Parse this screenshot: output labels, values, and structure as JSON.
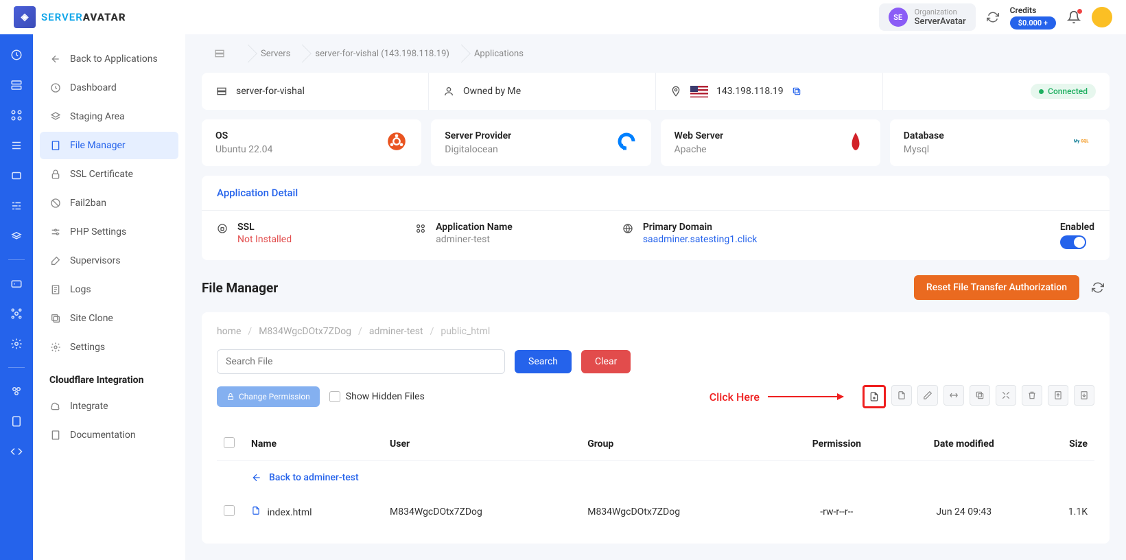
{
  "header": {
    "logo_text_1": "SERVER",
    "logo_text_2": "AVATAR",
    "org_label": "Organization",
    "org_name": "ServerAvatar",
    "org_initials": "SE",
    "credits_label": "Credits",
    "credits_value": "$0.000 +"
  },
  "breadcrumb_top": {
    "servers": "Servers",
    "server_detail": "server-for-vishal (143.198.118.19)",
    "applications": "Applications"
  },
  "sidenav": {
    "back": "Back to Applications",
    "items": [
      "Dashboard",
      "Staging Area",
      "File Manager",
      "SSL Certificate",
      "Fail2ban",
      "PHP Settings",
      "Supervisors",
      "Logs",
      "Site Clone",
      "Settings"
    ],
    "section": "Cloudflare Integration",
    "integrate": "Integrate",
    "docs": "Documentation"
  },
  "info_row": {
    "server_name": "server-for-vishal",
    "owner": "Owned by Me",
    "ip": "143.198.118.19",
    "status": "Connected"
  },
  "cards": {
    "os_title": "OS",
    "os_value": "Ubuntu 22.04",
    "provider_title": "Server Provider",
    "provider_value": "Digitalocean",
    "web_title": "Web Server",
    "web_value": "Apache",
    "db_title": "Database",
    "db_value": "Mysql"
  },
  "detail": {
    "header": "Application Detail",
    "ssl_label": "SSL",
    "ssl_value": "Not Installed",
    "app_label": "Application Name",
    "app_value": "adminer-test",
    "domain_label": "Primary Domain",
    "domain_value": "saadminer.satesting1.click",
    "enabled_label": "Enabled"
  },
  "fm": {
    "title": "File Manager",
    "reset_btn": "Reset File Transfer Authorization",
    "path": {
      "p1": "home",
      "p2": "M834WgcDOtx7ZDog",
      "p3": "adminer-test",
      "p4": "public_html"
    },
    "search_placeholder": "Search File",
    "search_btn": "Search",
    "clear_btn": "Clear",
    "change_perm": "Change Permission",
    "show_hidden": "Show Hidden Files",
    "annotation_text": "Click Here",
    "cols": {
      "name": "Name",
      "user": "User",
      "group": "Group",
      "permission": "Permission",
      "date": "Date modified",
      "size": "Size"
    },
    "back_row": "Back to adminer-test",
    "rows": [
      {
        "name": "index.html",
        "user": "M834WgcDOtx7ZDog",
        "group": "M834WgcDOtx7ZDog",
        "permission": "-rw-r--r--",
        "date": "Jun 24 09:43",
        "size": "1.1K"
      }
    ]
  }
}
